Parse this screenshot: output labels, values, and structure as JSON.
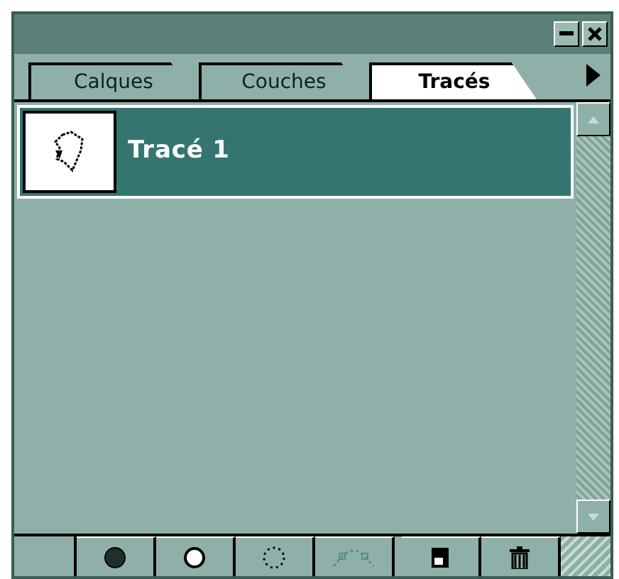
{
  "tabs": [
    {
      "label": "Calques",
      "selected": false
    },
    {
      "label": "Couches",
      "selected": false
    },
    {
      "label": "Tracés",
      "selected": true
    }
  ],
  "paths": [
    {
      "name": "Tracé 1",
      "selected": true
    }
  ],
  "toolbar": [
    {
      "kind": "fill",
      "disabled": false
    },
    {
      "kind": "stroke",
      "disabled": false
    },
    {
      "kind": "selection",
      "disabled": false
    },
    {
      "kind": "workpath",
      "disabled": true
    },
    {
      "kind": "new",
      "disabled": false
    },
    {
      "kind": "delete",
      "disabled": false
    }
  ]
}
